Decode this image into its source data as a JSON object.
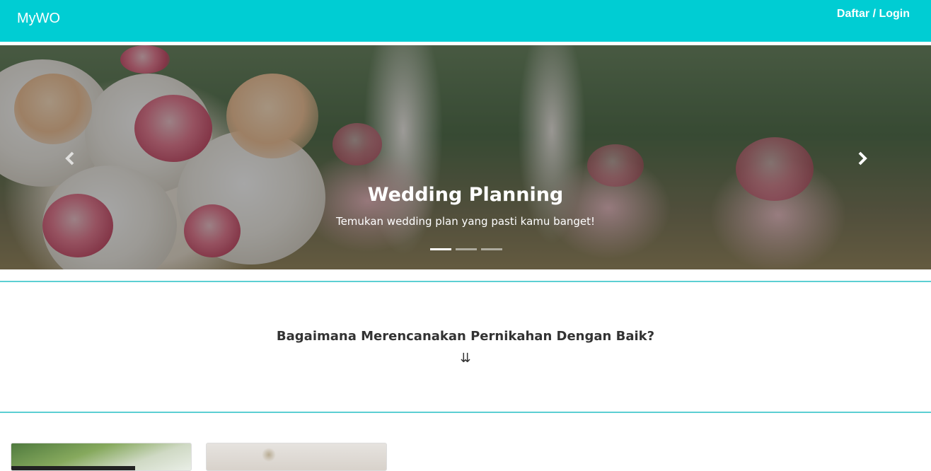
{
  "navbar": {
    "brand": "MyWO",
    "login_label": "Daftar / Login",
    "background_color": "#00cdd3"
  },
  "carousel": {
    "slide_title": "Wedding Planning",
    "slide_subtitle": "Temukan wedding plan yang pasti kamu banget!",
    "prev_icon": "chevron-left-icon",
    "next_icon": "chevron-right-icon",
    "indicator_count": 3,
    "active_indicator": 0
  },
  "section": {
    "title": "Bagaimana Merencanakan Pernikahan Dengan Baik?",
    "arrows": "⇊",
    "divider_color": "#5ccfd3"
  }
}
